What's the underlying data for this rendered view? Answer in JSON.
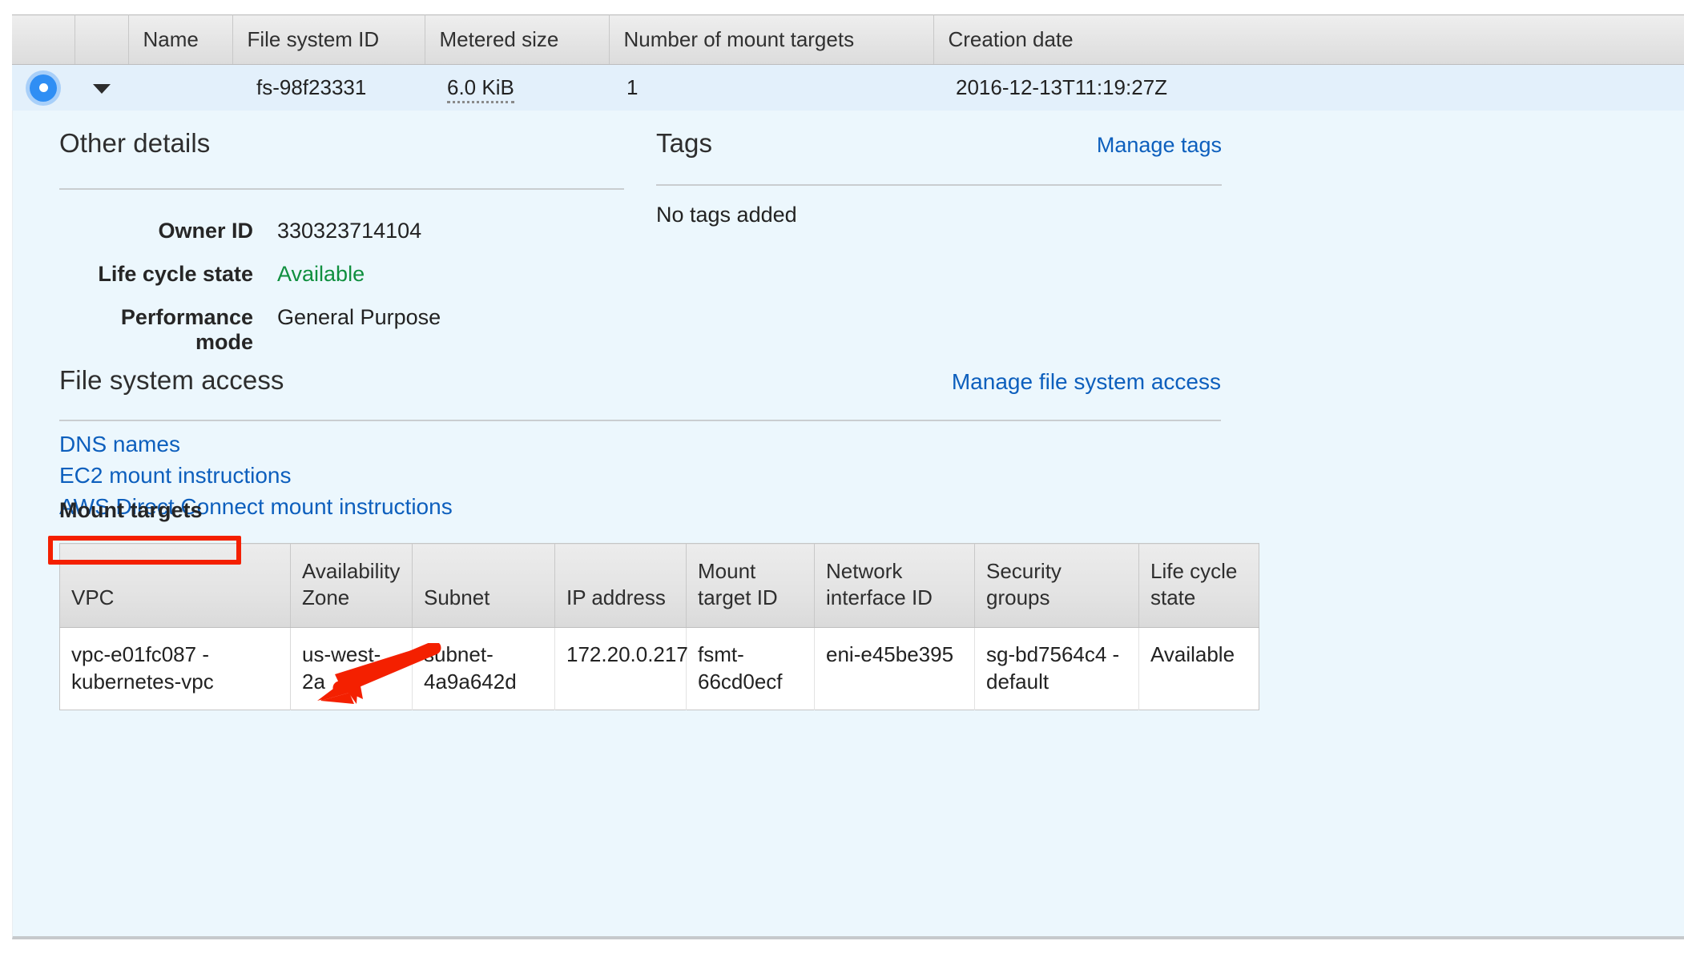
{
  "colors": {
    "link": "#0d5fbd",
    "available_green": "#0f8f3e",
    "annotation_red": "#f42000",
    "selected_row_blue": "#e3f0fb",
    "panel_blue": "#ecf7fd"
  },
  "filesystem_table": {
    "columns": [
      "",
      "",
      "Name",
      "File system ID",
      "Metered size",
      "Number of mount targets",
      "Creation date"
    ],
    "rows": [
      {
        "selected": true,
        "name": "",
        "file_system_id": "fs-98f23331",
        "metered_size": "6.0 KiB",
        "number_of_mount_targets": "1",
        "creation_date": "2016-12-13T11:19:27Z"
      }
    ]
  },
  "other_details": {
    "title": "Other details",
    "fields": [
      {
        "key": "Owner ID",
        "value": "330323714104"
      },
      {
        "key": "Life cycle state",
        "value": "Available"
      },
      {
        "key": "Performance mode",
        "value": "General Purpose"
      }
    ]
  },
  "tags": {
    "title": "Tags",
    "manage_link": "Manage tags",
    "empty_text": "No tags added"
  },
  "file_system_access": {
    "title": "File system access",
    "manage_link": "Manage file system access",
    "links": [
      "DNS names",
      "EC2 mount instructions",
      "AWS Direct Connect mount instructions"
    ]
  },
  "mount_targets": {
    "title": "Mount targets",
    "columns": [
      "VPC",
      "Availability Zone",
      "Subnet",
      "IP address",
      "Mount target ID",
      "Network interface ID",
      "Security groups",
      "Life cycle state"
    ],
    "rows": [
      {
        "vpc": "vpc-e01fc087 - kubernetes-vpc",
        "availability_zone": "us-west-2a",
        "subnet": "subnet-4a9a642d",
        "ip_address": "172.20.0.217",
        "mount_target_id": "fsmt-66cd0ecf",
        "network_interface_id": "eni-e45be395",
        "security_groups": "sg-bd7564c4 - default",
        "life_cycle_state": "Available"
      }
    ]
  },
  "annotation": {
    "highlight_target": "EC2 mount instructions",
    "shape": "red-rectangle-with-arrow"
  }
}
